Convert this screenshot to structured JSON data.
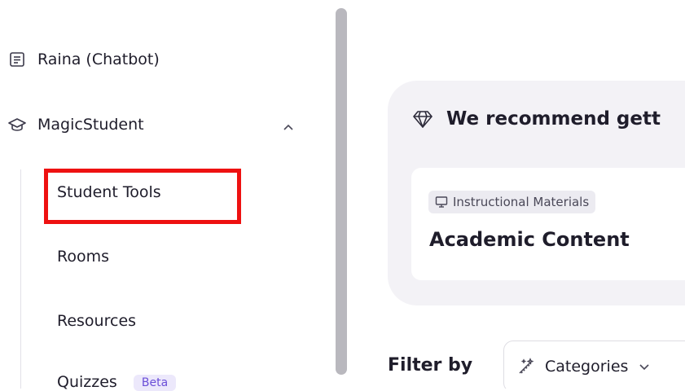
{
  "sidebar": {
    "raina_label": "Raina (Chatbot)",
    "magicstudent_label": "MagicStudent",
    "sub_items": [
      {
        "label": "Student Tools"
      },
      {
        "label": "Rooms"
      },
      {
        "label": "Resources"
      },
      {
        "label": "Quizzes",
        "badge": "Beta"
      }
    ]
  },
  "main": {
    "recommend_title": "We recommend gett",
    "tag_label": "Instructional Materials",
    "content_title": "Academic Content",
    "filter_label": "Filter by",
    "categories_label": "Categories"
  },
  "colors": {
    "highlight": "#ee1111",
    "beta_text": "#6b4fd8",
    "card_bg": "#f3f2f6"
  },
  "icons": {
    "raina": "chat-document-icon",
    "magicstudent": "graduation-cap-icon",
    "recommend": "diamond-icon",
    "tag": "presentation-board-icon",
    "categories": "magic-wand-icon"
  }
}
